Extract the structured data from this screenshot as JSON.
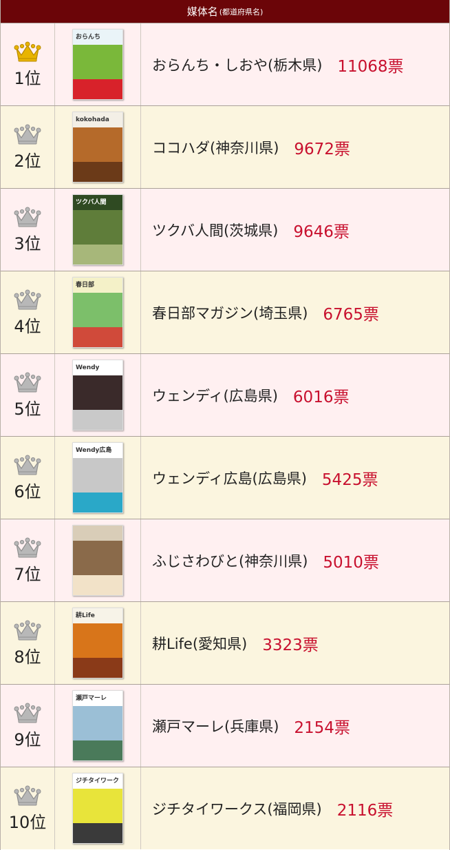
{
  "header": {
    "title": "媒体名",
    "subtitle": "(都道府県名)"
  },
  "colors": {
    "header_bg": "#6b0508",
    "votes": "#c8102e",
    "crown_gold": "#e8b400",
    "crown_silver": "#b8b8b8",
    "row_pink": "#fff0f1",
    "row_cream": "#fbf5df"
  },
  "rows": [
    {
      "rank": "1位",
      "crown": "gold-crown-icon",
      "name": "おらんち・しおや(栃木県)",
      "votes": "11068票",
      "cover_title": "おらんち",
      "cover_colors": [
        "#eaf4f8",
        "#7ab83a",
        "#d8222a"
      ]
    },
    {
      "rank": "2位",
      "crown": "silver-crown-icon",
      "name": "ココハダ(神奈川県)",
      "votes": "9672票",
      "cover_title": "kokohada",
      "cover_colors": [
        "#f3efe6",
        "#b56a2a",
        "#6b3a18"
      ]
    },
    {
      "rank": "3位",
      "crown": "silver-crown-icon",
      "name": "ツクバ人間(茨城県)",
      "votes": "9646票",
      "cover_title": "ツクバ人間",
      "cover_colors": [
        "#2f4a22",
        "#5f7d3a",
        "#a7b77a"
      ]
    },
    {
      "rank": "4位",
      "crown": "silver-crown-icon",
      "name": "春日部マガジン(埼玉県)",
      "votes": "6765票",
      "cover_title": "春日部",
      "cover_colors": [
        "#f4f1c8",
        "#7cbf6a",
        "#d04a3a"
      ]
    },
    {
      "rank": "5位",
      "crown": "silver-crown-icon",
      "name": "ウェンディ(広島県)",
      "votes": "6016票",
      "cover_title": "Wendy",
      "cover_colors": [
        "#ffffff",
        "#3a2a2a",
        "#c9c9c9"
      ]
    },
    {
      "rank": "6位",
      "crown": "silver-crown-icon",
      "name": "ウェンディ広島(広島県)",
      "votes": "5425票",
      "cover_title": "Wendy広島",
      "cover_colors": [
        "#ffffff",
        "#c8c8c8",
        "#2aa8c8"
      ]
    },
    {
      "rank": "7位",
      "crown": "silver-crown-icon",
      "name": "ふじさわびと(神奈川県)",
      "votes": "5010票",
      "cover_title": "",
      "cover_colors": [
        "#d9cdb8",
        "#8a6a4a",
        "#f2e2c8"
      ]
    },
    {
      "rank": "8位",
      "crown": "silver-crown-icon",
      "name": "耕Life(愛知県)",
      "votes": "3323票",
      "cover_title": "耕Life",
      "cover_colors": [
        "#f7f3e8",
        "#d8751a",
        "#8a3a18"
      ]
    },
    {
      "rank": "9位",
      "crown": "silver-crown-icon",
      "name": "瀬戸マーレ(兵庫県)",
      "votes": "2154票",
      "cover_title": "瀬戸マーレ",
      "cover_colors": [
        "#ffffff",
        "#9bbfd6",
        "#4a7a5a"
      ]
    },
    {
      "rank": "10位",
      "crown": "silver-crown-icon",
      "name": "ジチタイワークス(福岡県)",
      "votes": "2116票",
      "cover_title": "ジチタイワークス",
      "cover_colors": [
        "#ffffff",
        "#e8e43a",
        "#3a3a3a"
      ]
    }
  ]
}
